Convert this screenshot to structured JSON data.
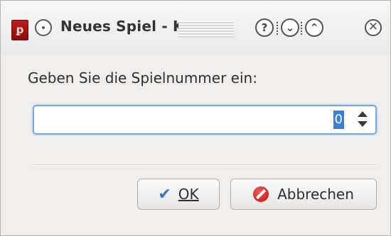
{
  "window": {
    "title": "Neues Spiel - KI",
    "buttons": {
      "help": "?",
      "minimize": "⌄",
      "maximize": "⌃",
      "close": "✕"
    }
  },
  "dialog": {
    "prompt": "Geben Sie die Spielnummer ein:",
    "spinbox_value": "0"
  },
  "actions": {
    "ok_label": "OK",
    "cancel_label": "Abbrechen"
  },
  "icons": {
    "app": "mahjongg-tile-icon",
    "ok": "checkmark-icon",
    "cancel": "cancel-icon"
  },
  "colors": {
    "accent": "#3b7ed6",
    "cancel": "#c41010"
  }
}
